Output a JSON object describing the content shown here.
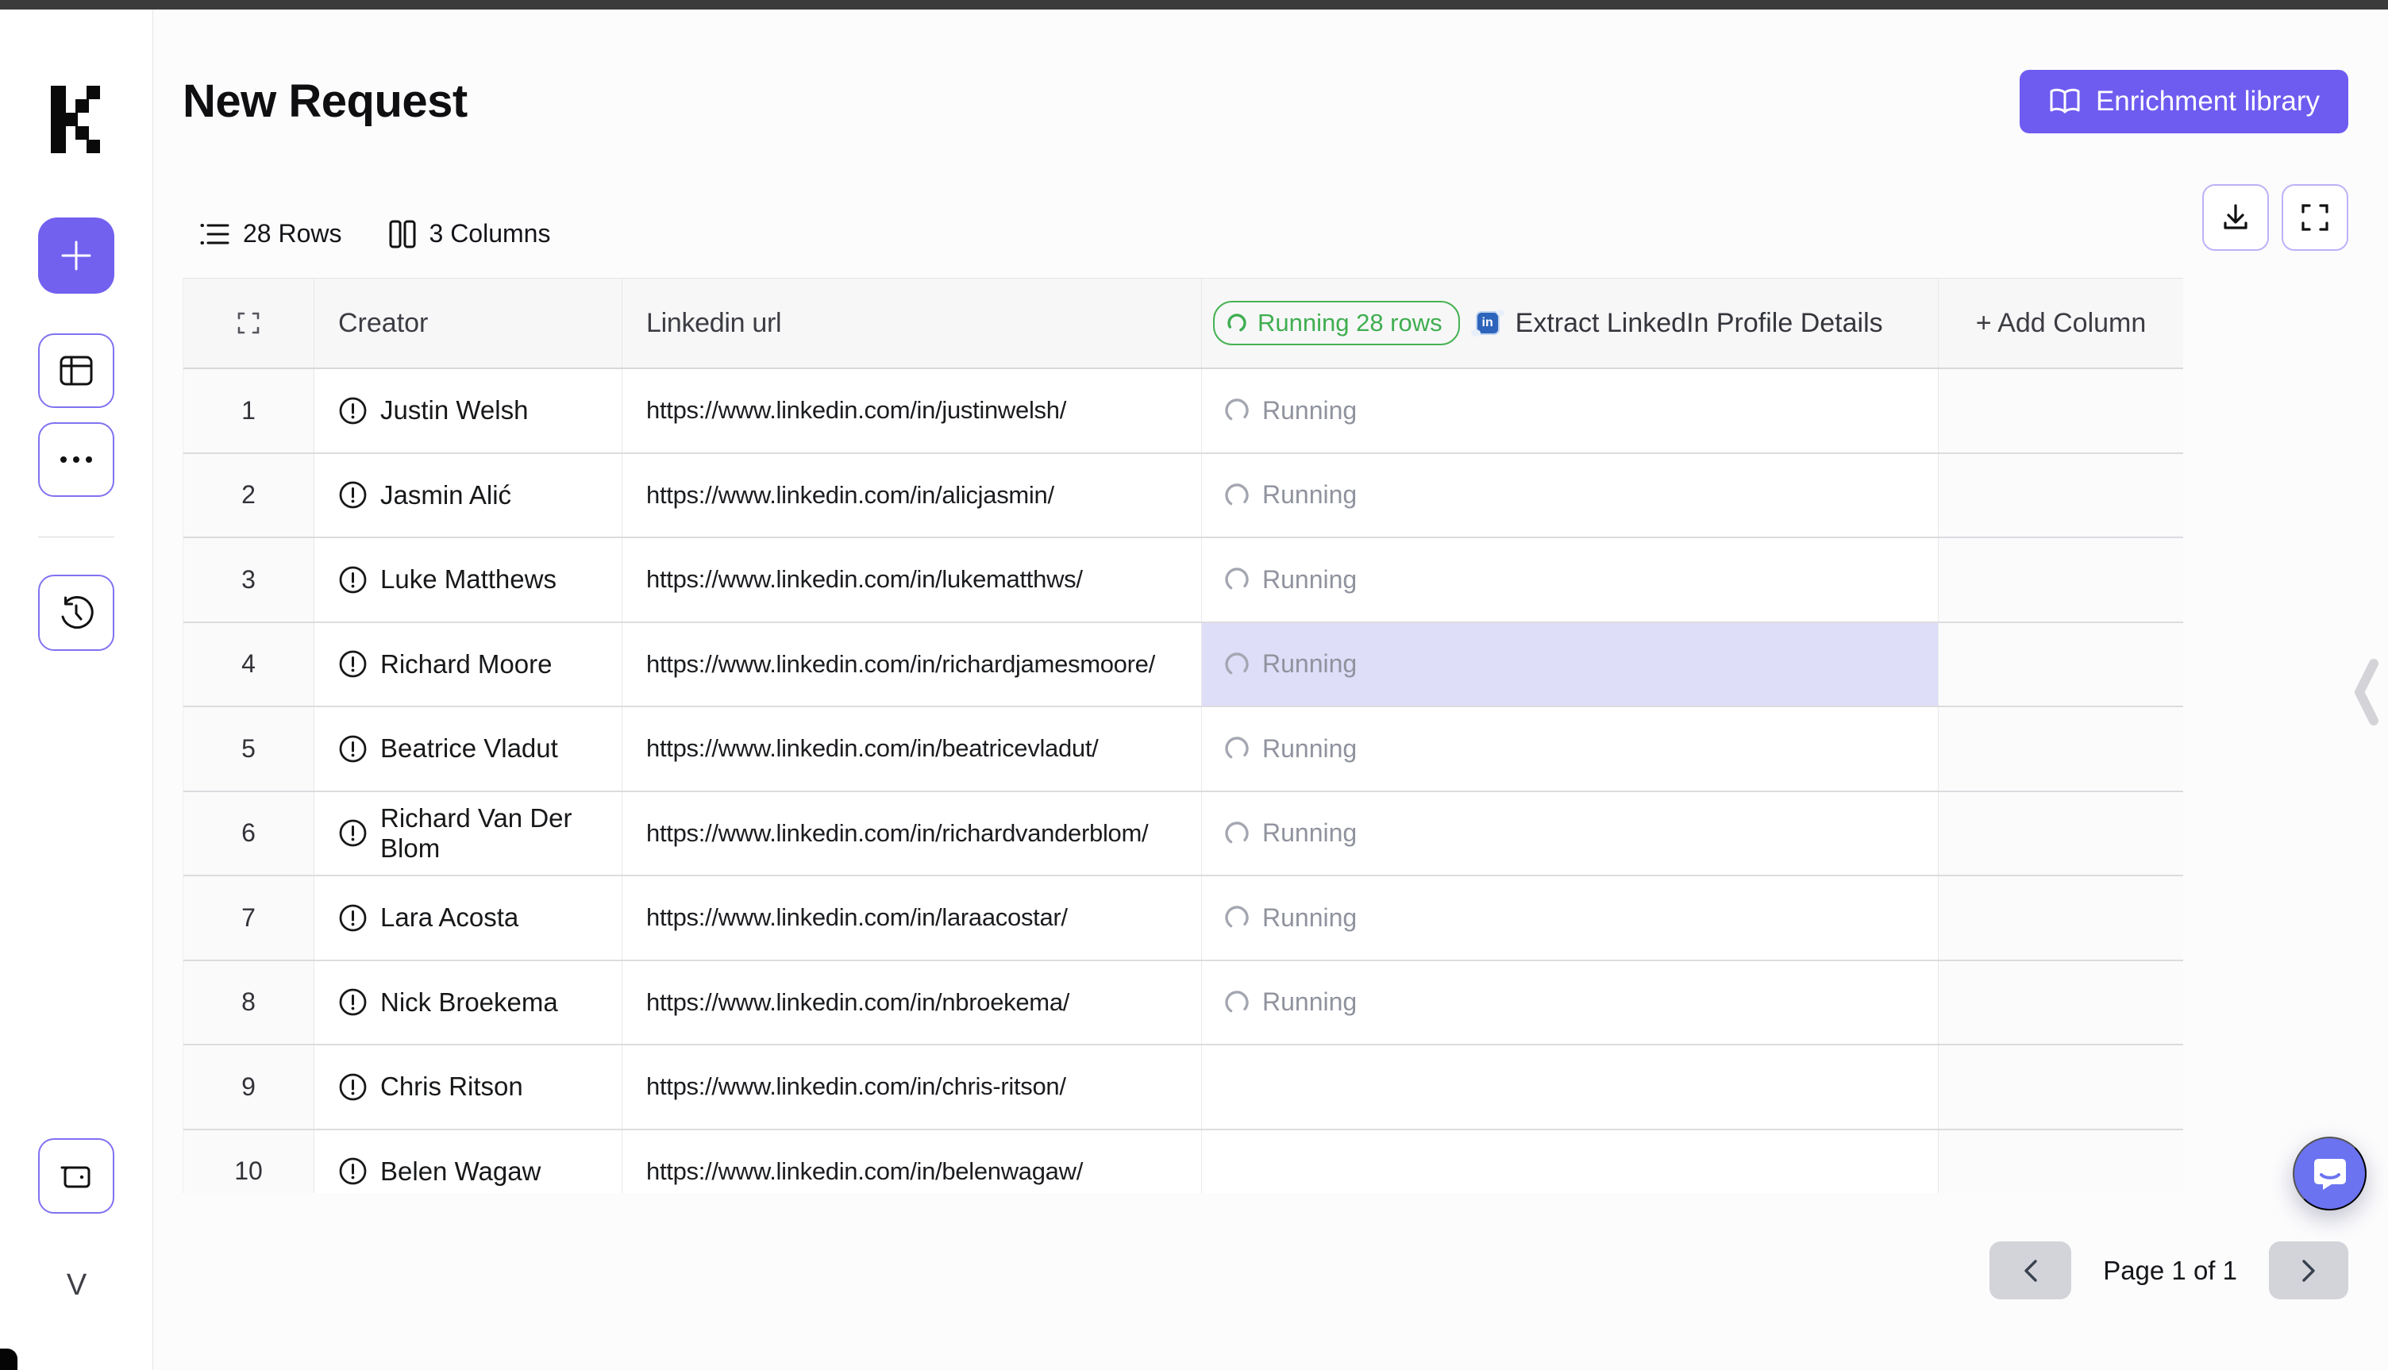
{
  "app": {
    "topbar_color": "#3B3B3C",
    "accent": "#6E5CF0",
    "highlight": "#DEDEF8",
    "running_green": "#3FAE50"
  },
  "sidebar": {
    "initial": "V"
  },
  "header": {
    "title": "New Request",
    "enrichment_button": "Enrichment library"
  },
  "toolbar": {
    "rows_label": "28 Rows",
    "columns_label": "3 Columns"
  },
  "table": {
    "running_badge": "Running 28 rows",
    "columns": {
      "creator": "Creator",
      "linkedin": "Linkedin url",
      "enrichment": "Extract LinkedIn Profile Details",
      "add_column": "+ Add Column"
    },
    "rows": [
      {
        "num": "1",
        "name": "Justin Welsh",
        "url": "https://www.linkedin.com/in/justinwelsh/",
        "status": "Running",
        "highlight": false
      },
      {
        "num": "2",
        "name": "Jasmin Alić",
        "url": "https://www.linkedin.com/in/alicjasmin/",
        "status": "Running",
        "highlight": false
      },
      {
        "num": "3",
        "name": "Luke Matthews",
        "url": "https://www.linkedin.com/in/lukematthws/",
        "status": "Running",
        "highlight": false
      },
      {
        "num": "4",
        "name": "Richard Moore",
        "url": "https://www.linkedin.com/in/richardjamesmoore/",
        "status": "Running",
        "highlight": true
      },
      {
        "num": "5",
        "name": "Beatrice Vladut",
        "url": "https://www.linkedin.com/in/beatricevladut/",
        "status": "Running",
        "highlight": false
      },
      {
        "num": "6",
        "name": "Richard Van Der Blom",
        "url": "https://www.linkedin.com/in/richardvanderblom/",
        "status": "Running",
        "highlight": false
      },
      {
        "num": "7",
        "name": "Lara Acosta",
        "url": "https://www.linkedin.com/in/laraacostar/",
        "status": "Running",
        "highlight": false
      },
      {
        "num": "8",
        "name": "Nick Broekema",
        "url": "https://www.linkedin.com/in/nbroekema/",
        "status": "Running",
        "highlight": false
      },
      {
        "num": "9",
        "name": "Chris Ritson",
        "url": "https://www.linkedin.com/in/chris-ritson/",
        "status": "",
        "highlight": false
      },
      {
        "num": "10",
        "name": "Belen Wagaw",
        "url": "https://www.linkedin.com/in/belenwagaw/",
        "status": "",
        "highlight": false
      }
    ]
  },
  "pagination": {
    "label": "Page 1 of 1"
  }
}
